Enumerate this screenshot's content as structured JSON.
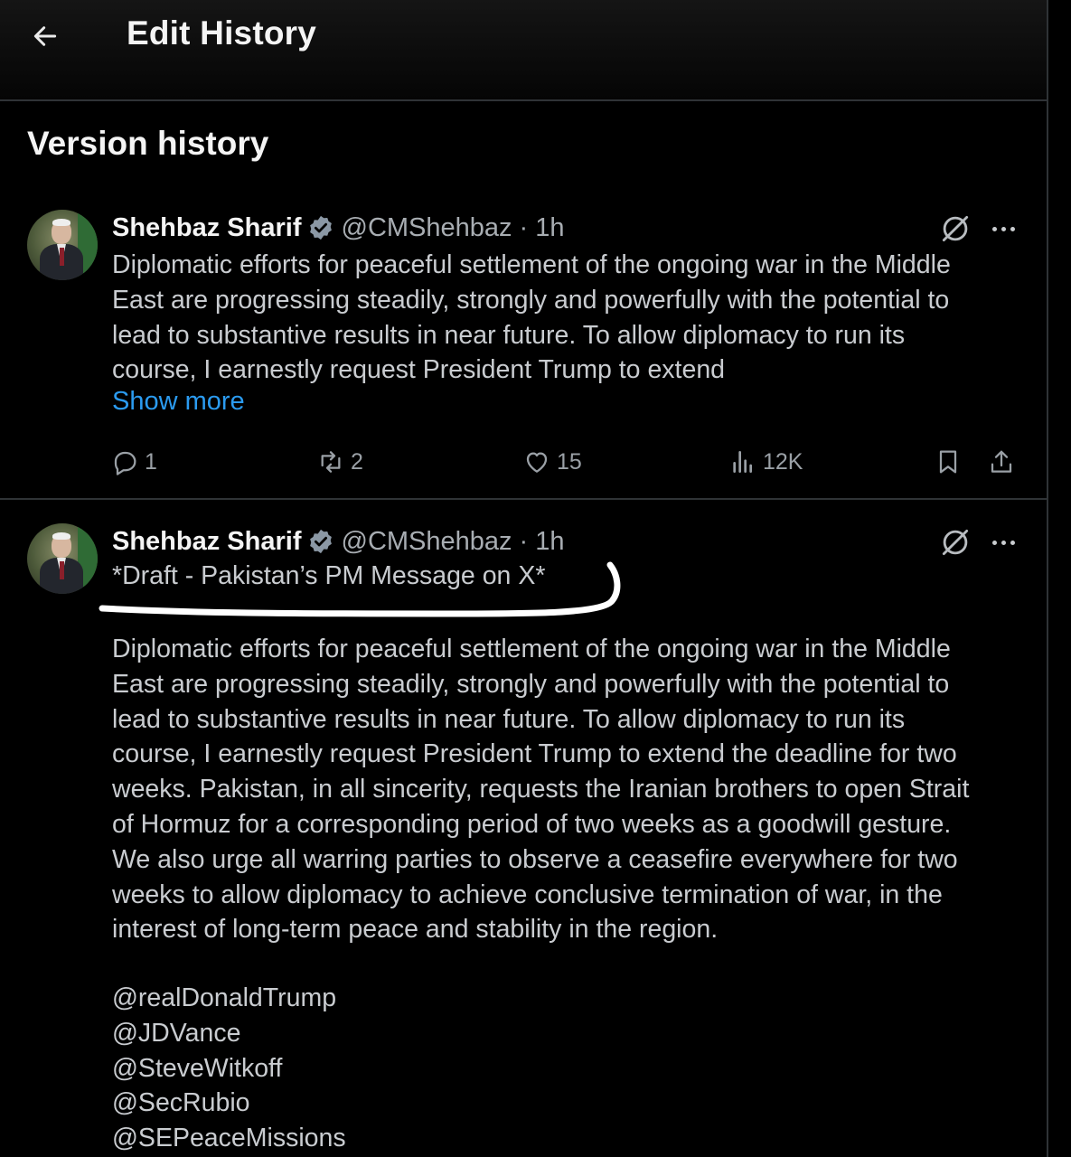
{
  "header": {
    "title": "Edit History"
  },
  "section": {
    "title": "Version history"
  },
  "tweets": [
    {
      "author": "Shehbaz Sharif",
      "handle": "@CMShehbaz",
      "separator": "·",
      "time": "1h",
      "text": "Diplomatic efforts for peaceful settlement of the ongoing war in the Middle\nEast are progressing steadily, strongly and powerfully with the potential to\nlead to substantive results in near future. To allow diplomacy to run its\ncourse, I earnestly request President Trump to extend",
      "show_more": "Show more",
      "stats": {
        "replies": "1",
        "reposts": "2",
        "likes": "15",
        "views": "12K"
      }
    },
    {
      "author": "Shehbaz Sharif",
      "handle": "@CMShehbaz",
      "separator": "·",
      "time": "1h",
      "subtitle": "*Draft - Pakistan’s PM Message on X*",
      "text": "Diplomatic efforts for peaceful settlement of the ongoing war in the Middle\nEast are progressing steadily, strongly and powerfully with the potential to\nlead to substantive results in near future. To allow diplomacy to run its\ncourse, I earnestly request President Trump to extend the deadline for two\nweeks. Pakistan, in all sincerity, requests the Iranian brothers to open Strait\nof Hormuz for a corresponding period of two weeks as a goodwill gesture.\nWe also urge all warring parties to observe a ceasefire everywhere for two\nweeks to allow diplomacy to achieve conclusive termination of war, in the\ninterest of long-term peace and stability in the region.",
      "mentions": [
        "@realDonaldTrump",
        "@JDVance",
        "@SteveWitkoff",
        "@SecRubio",
        "@SEPeaceMissions"
      ]
    }
  ],
  "icons": [
    "back-arrow-icon",
    "verified-icon",
    "edit-icon",
    "more-icon",
    "reply-icon",
    "repost-icon",
    "like-icon",
    "views-icon",
    "bookmark-icon",
    "share-icon"
  ],
  "colors": {
    "background": "#000000",
    "text": "#e7e9ea",
    "muted": "#a8adb2",
    "link": "#2b9bf0",
    "verified": "#8b98a5",
    "divider": "#2f3336"
  }
}
